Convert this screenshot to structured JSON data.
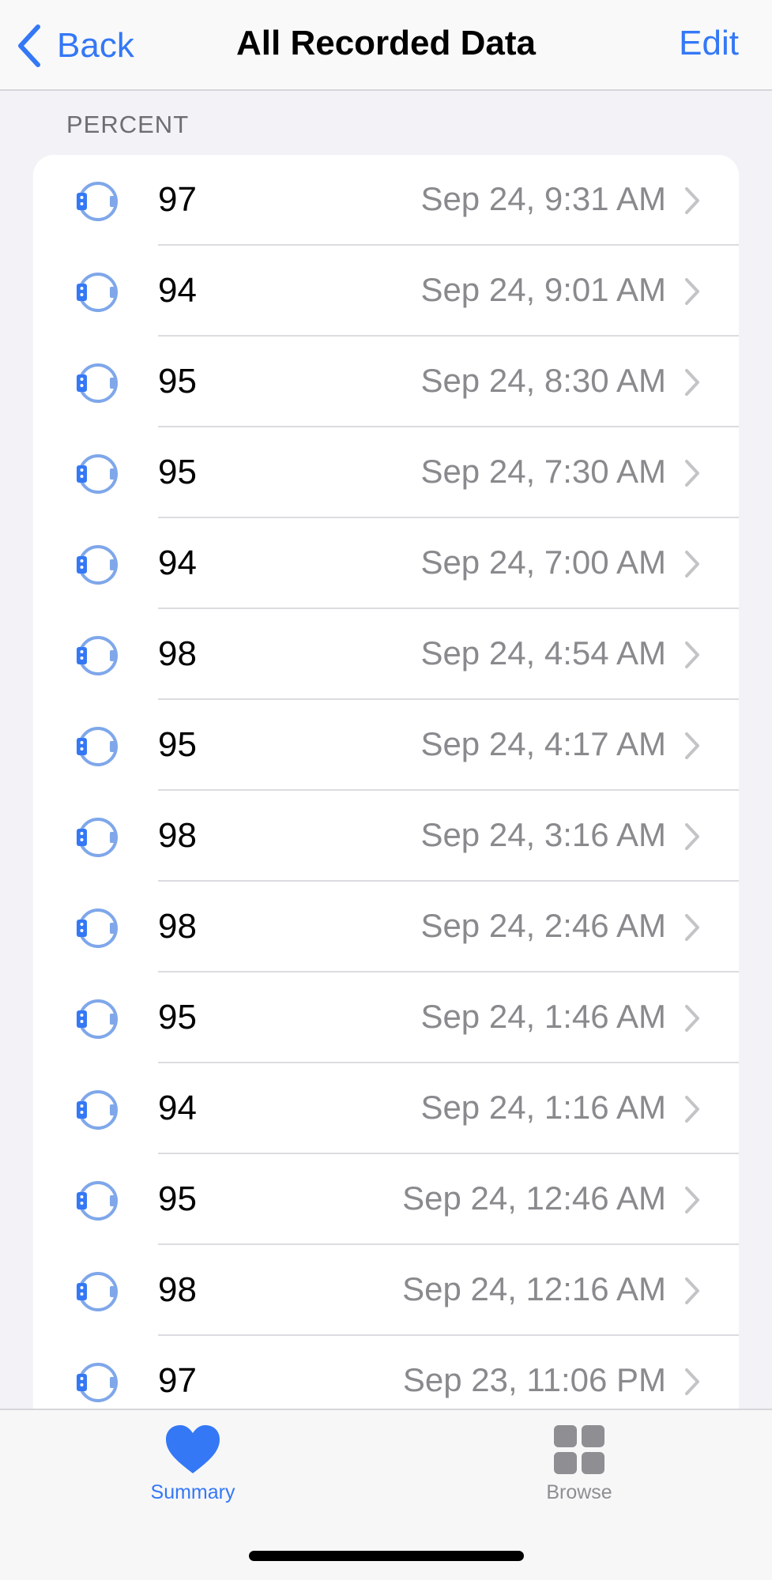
{
  "nav": {
    "back_label": "Back",
    "title": "All Recorded Data",
    "edit_label": "Edit"
  },
  "section": {
    "header": "PERCENT"
  },
  "records": [
    {
      "value": "97",
      "date": "Sep 24, 9:31 AM"
    },
    {
      "value": "94",
      "date": "Sep 24, 9:01 AM"
    },
    {
      "value": "95",
      "date": "Sep 24, 8:30 AM"
    },
    {
      "value": "95",
      "date": "Sep 24, 7:30 AM"
    },
    {
      "value": "94",
      "date": "Sep 24, 7:00 AM"
    },
    {
      "value": "98",
      "date": "Sep 24, 4:54 AM"
    },
    {
      "value": "95",
      "date": "Sep 24, 4:17 AM"
    },
    {
      "value": "98",
      "date": "Sep 24, 3:16 AM"
    },
    {
      "value": "98",
      "date": "Sep 24, 2:46 AM"
    },
    {
      "value": "95",
      "date": "Sep 24, 1:46 AM"
    },
    {
      "value": "94",
      "date": "Sep 24, 1:16 AM"
    },
    {
      "value": "95",
      "date": "Sep 24, 12:46 AM"
    },
    {
      "value": "98",
      "date": "Sep 24, 12:16 AM"
    },
    {
      "value": "97",
      "date": "Sep 23, 11:06 PM"
    }
  ],
  "row_icon": "apple-watch-icon",
  "tabbar": {
    "summary_label": "Summary",
    "summary_icon": "heart-icon",
    "browse_label": "Browse",
    "browse_icon": "grid-icon"
  },
  "colors": {
    "accent": "#3478f6",
    "secondary_text": "#8a8a8e",
    "background": "#f2f2f7"
  }
}
